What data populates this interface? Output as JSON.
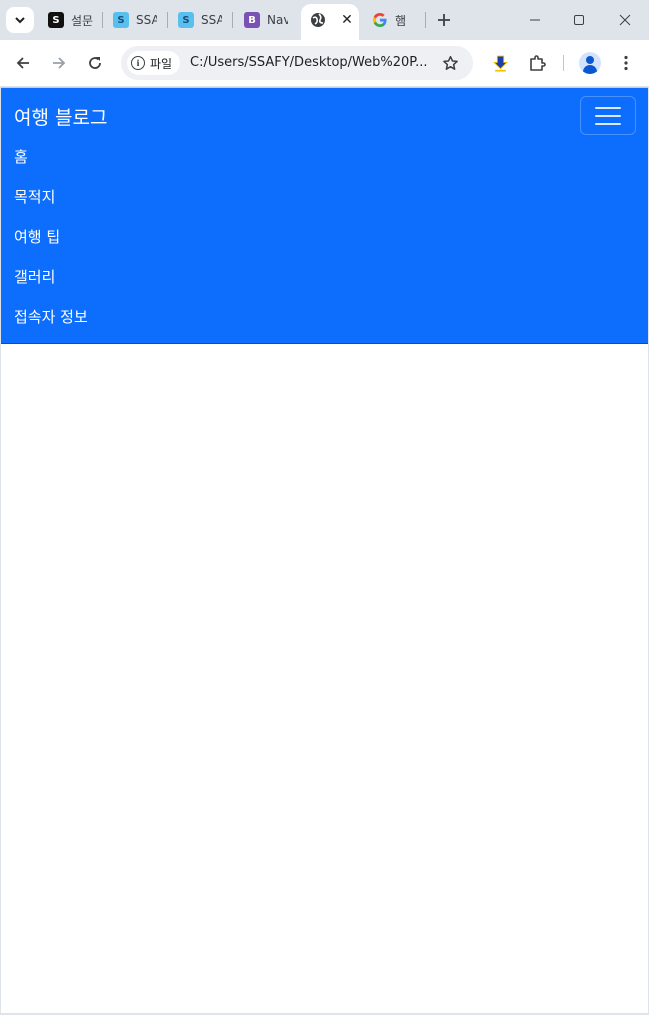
{
  "browser": {
    "tabs": [
      {
        "title": "설문",
        "favicon": "notion-icon"
      },
      {
        "title": "SSA",
        "favicon": "ssafy-icon"
      },
      {
        "title": "SSA",
        "favicon": "ssafy-icon"
      },
      {
        "title": "Nav",
        "favicon": "bootstrap-icon"
      },
      {
        "title": "",
        "favicon": "globe-icon",
        "active": true
      },
      {
        "title": "햄",
        "favicon": "google-icon"
      }
    ],
    "address": {
      "chip_label": "파일",
      "url": "C:/Users/SSAFY/Desktop/Web%20P..."
    }
  },
  "page": {
    "brand": "여행 블로그",
    "nav_items": [
      "홈",
      "목적지",
      "여행 팁",
      "갤러리",
      "접속자 정보"
    ]
  },
  "colors": {
    "navbar_bg": "#0d6efd",
    "text": "#ffffff",
    "bootstrap_purple": "#7952b3"
  }
}
